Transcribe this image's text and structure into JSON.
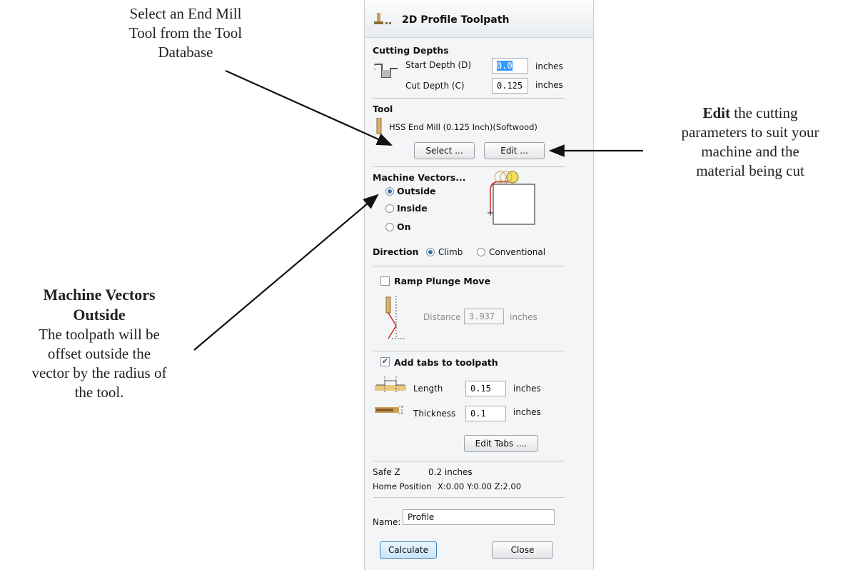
{
  "callouts": {
    "select": [
      "Select an End Mill",
      "Tool from the Tool",
      "Database"
    ],
    "edit": {
      "bold": "Edit",
      "line1_rest": " the cutting",
      "line2": "parameters to suit your",
      "line3": "machine and the",
      "line4": "material being cut"
    },
    "machine": {
      "title1": "Machine Vectors",
      "title2": "Outside",
      "body": [
        "The toolpath will be",
        "offset outside the",
        "vector by the radius of",
        "the tool."
      ]
    }
  },
  "panel": {
    "title": "2D Profile Toolpath",
    "cutting_depths": {
      "heading": "Cutting Depths",
      "start_label": "Start Depth (D)",
      "start_value": "0.0",
      "cut_label": "Cut Depth (C)",
      "cut_value": "0.125",
      "unit": "inches"
    },
    "tool": {
      "heading": "Tool",
      "name": "HSS End Mill (0.125 Inch)(Softwood)",
      "select_label": "Select ...",
      "edit_label": "Edit ..."
    },
    "machine_vectors": {
      "heading": "Machine Vectors...",
      "options": [
        "Outside",
        "Inside",
        "On"
      ],
      "selected": "Outside"
    },
    "direction": {
      "label": "Direction",
      "options": [
        "Climb",
        "Conventional"
      ],
      "selected": "Climb"
    },
    "ramp": {
      "label": "Ramp Plunge Move",
      "checked": false,
      "distance_label": "Distance",
      "distance_value": "3.937",
      "unit": "inches"
    },
    "tabs": {
      "label": "Add tabs to toolpath",
      "checked": true,
      "length_label": "Length",
      "length_value": "0.15",
      "thickness_label": "Thickness",
      "thickness_value": "0.1",
      "unit": "inches",
      "edit_tabs_label": "Edit Tabs ...."
    },
    "safe_z": {
      "label": "Safe Z",
      "value": "0.2 inches"
    },
    "home": {
      "label": "Home Position",
      "value": "X:0.00 Y:0.00 Z:2.00"
    },
    "name": {
      "label": "Name:",
      "value": "Profile"
    },
    "calculate_label": "Calculate",
    "close_label": "Close"
  },
  "colors": {
    "selection": "#3399ff",
    "radio_dot": "#2f6fb3",
    "primary_button": "#c6e4f7"
  }
}
